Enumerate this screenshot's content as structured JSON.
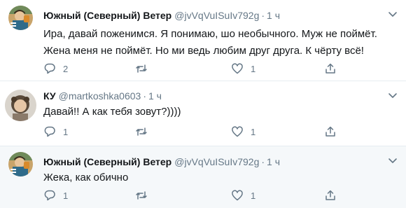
{
  "tweets": [
    {
      "name": "Южный (Северный) Ветер",
      "handle": "@jvVqVuISuIv792g",
      "dot": "·",
      "time": "1 ч",
      "lines": [
        "Ира, давай поженимся. Я понимаю, шо необычного. Муж не поймёт.",
        "Жена меня не поймёт. Но ми ведь любим друг друга. К чёрту всё!"
      ],
      "reply_count": "2",
      "retweet_count": "",
      "like_count": "1"
    },
    {
      "name": "КУ",
      "handle": "@martkoshka0603",
      "dot": "·",
      "time": "1 ч",
      "lines": [
        "Давай!! А как тебя зовут?))))"
      ],
      "reply_count": "1",
      "retweet_count": "",
      "like_count": "1"
    },
    {
      "name": "Южный (Северный) Ветер",
      "handle": "@jvVqVuISuIv792g",
      "dot": "·",
      "time": "1 ч",
      "lines": [
        "Жека, как обично"
      ],
      "reply_count": "1",
      "retweet_count": "",
      "like_count": "1"
    }
  ],
  "colors": {
    "text": "#14171a",
    "secondary": "#657786",
    "border": "#e6ecf0",
    "highlight_bg": "#f5f8fa"
  },
  "icons": [
    "avatar",
    "caret-down-icon",
    "reply-icon",
    "retweet-icon",
    "like-icon",
    "share-icon"
  ]
}
